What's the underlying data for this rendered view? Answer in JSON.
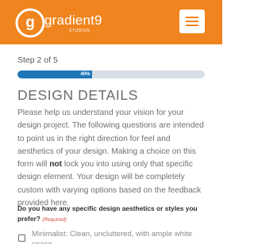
{
  "header": {
    "brand_name": "gradient9",
    "brand_sub": "STUDIOS",
    "logo_letter": "g",
    "menu_icon": "hamburger-icon",
    "colors": {
      "brand": "#f0841e",
      "white": "#ffffff"
    }
  },
  "form": {
    "step_label": "Step 2 of 5",
    "progress": {
      "percent": 40,
      "label": "40%",
      "color": "#1e76b9"
    },
    "title": "DESIGN DETAILS",
    "intro_before": "Please help us understand your vision for your design project. The following questions are intended to point us in the right direction for feel and aesthetics of your design. Making a choice on this form will ",
    "intro_bold": "not",
    "intro_after": " lock you into using only that specific design element. Your design will be completely custom with varying options based on the feedback provided here.",
    "question": "Do you have any specific design aesthetics or styles you prefer?",
    "required_label": "(Required)",
    "options": [
      {
        "label": "Minimalist: Clean, uncluttered, with ample white space",
        "checked": false
      }
    ]
  }
}
